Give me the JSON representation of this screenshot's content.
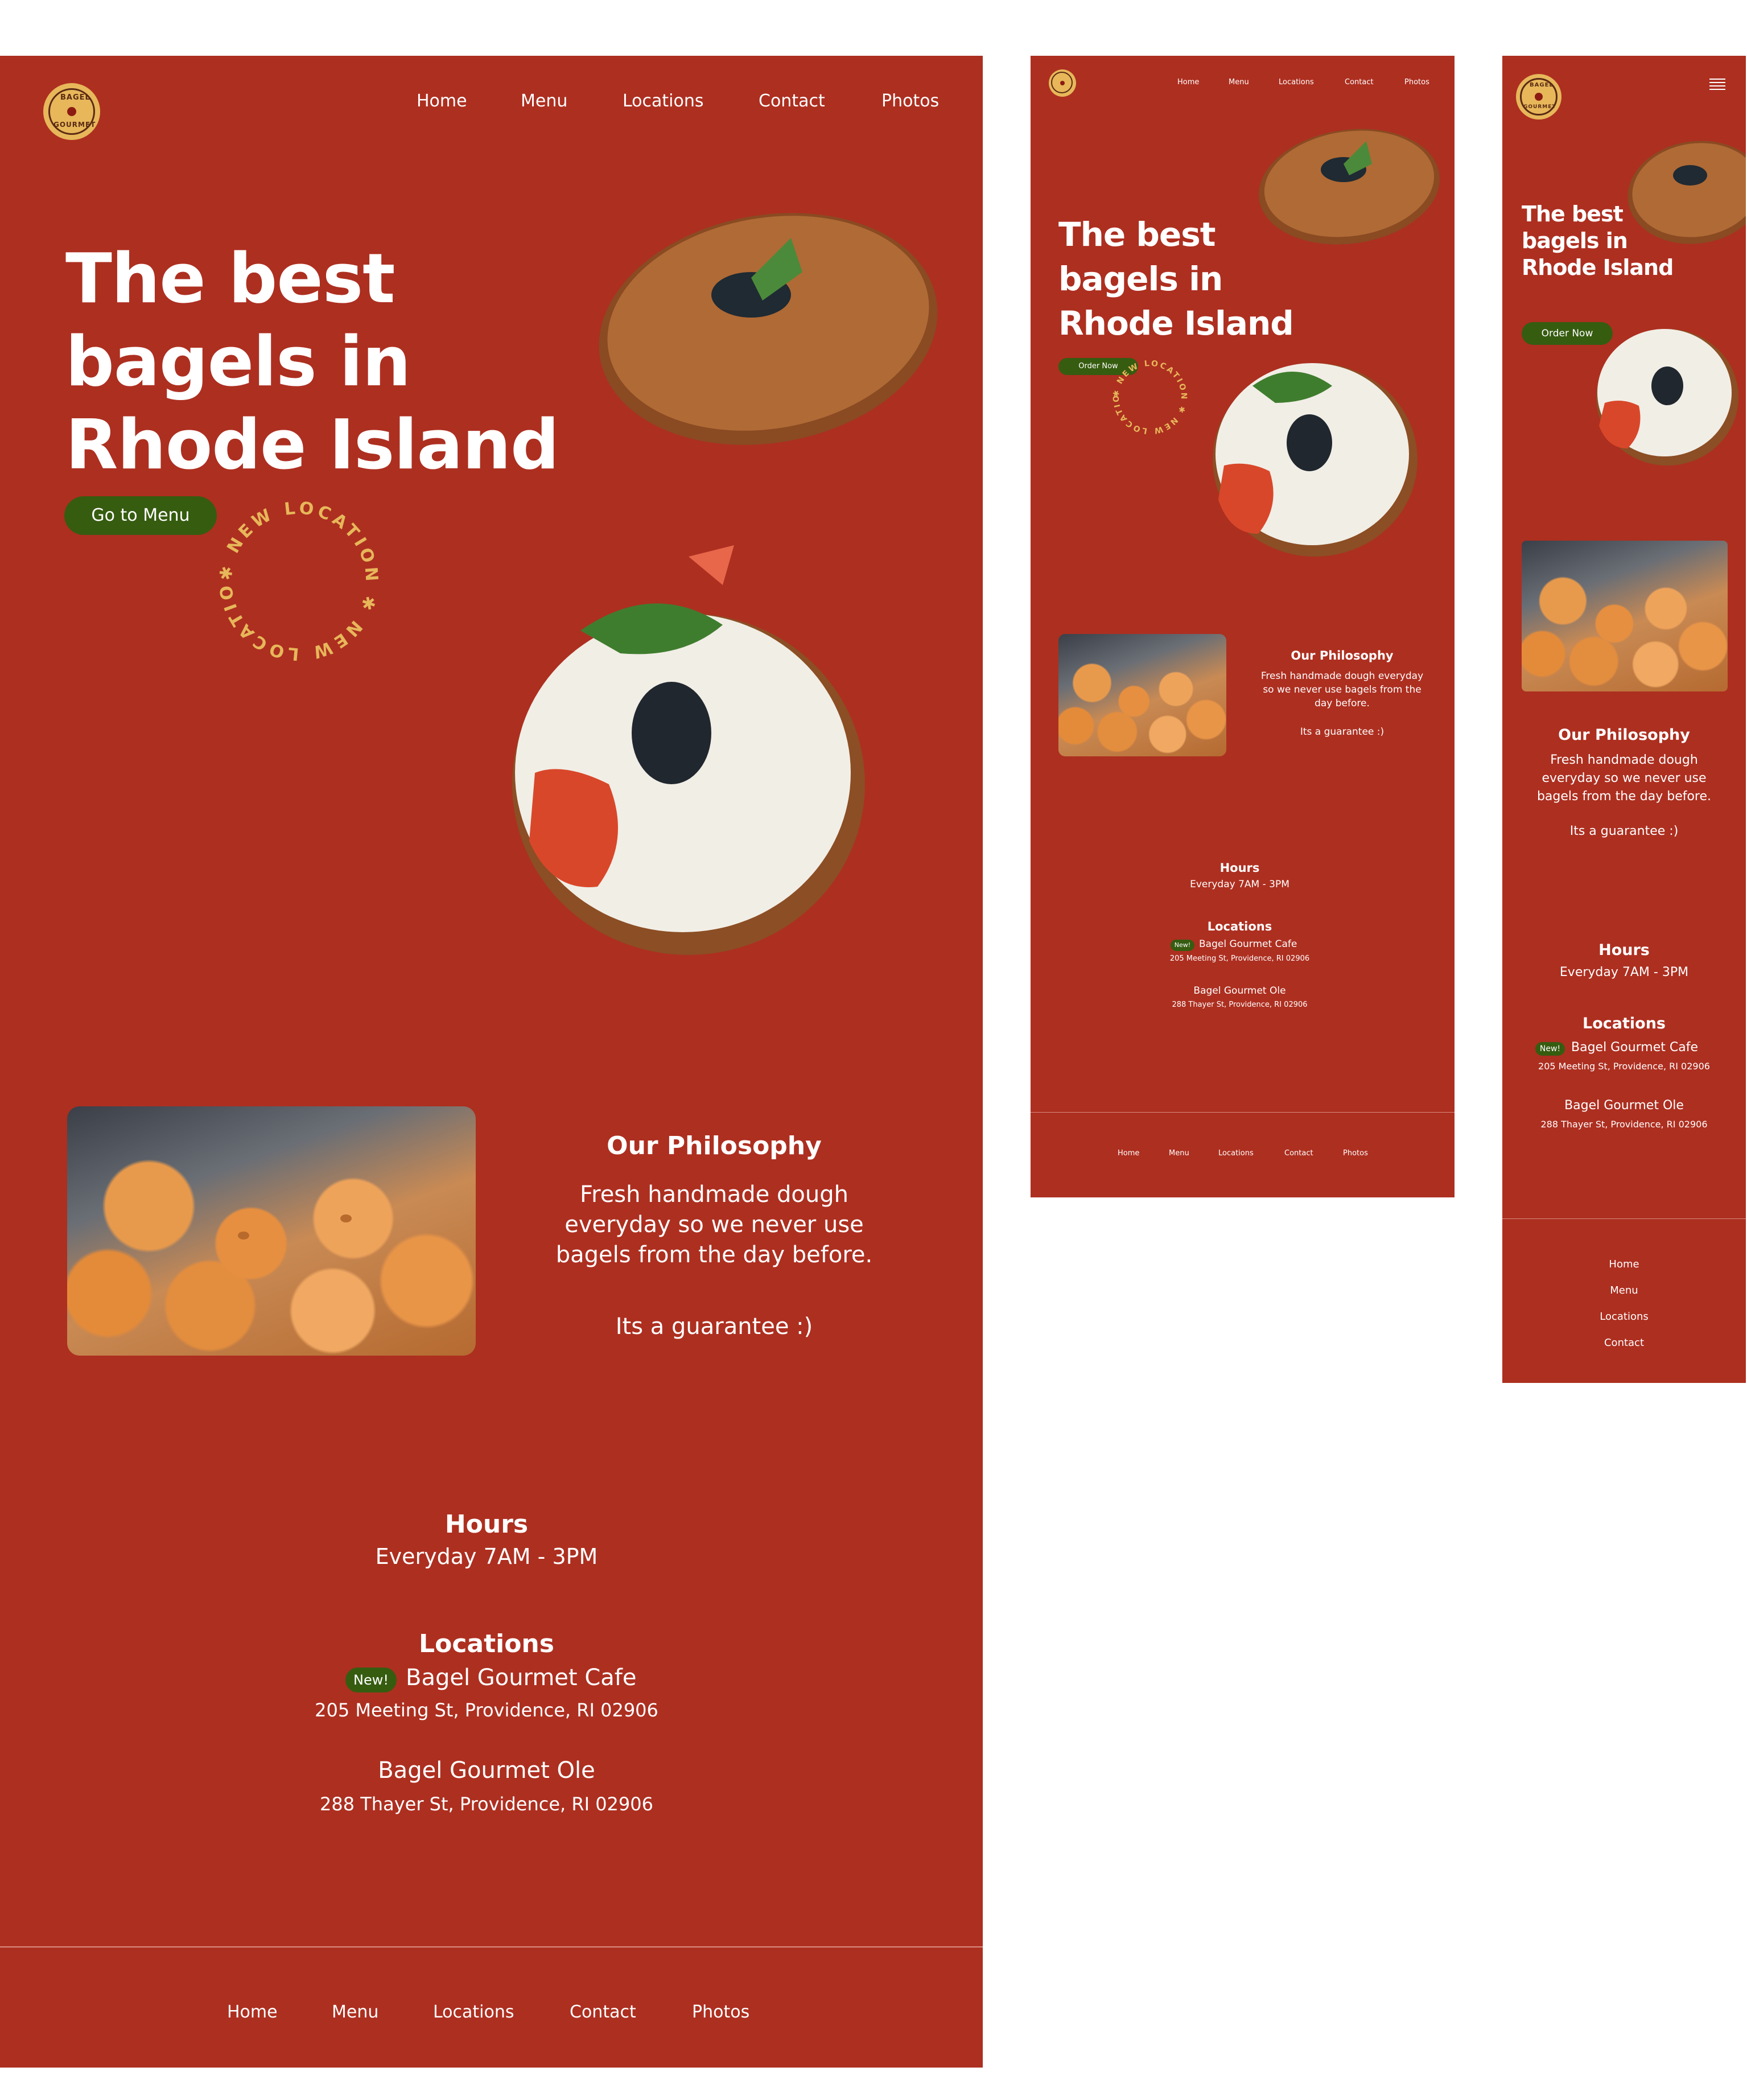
{
  "brand": {
    "logo_line1": "BAGEL",
    "logo_line2": "GOURMET"
  },
  "nav": [
    "Home",
    "Menu",
    "Locations",
    "Contact",
    "Photos"
  ],
  "hero": {
    "line1": "The best",
    "line2": "bagels in",
    "line3": "Rhode Island",
    "desktop_button": "Go to Menu",
    "mobile_button": "Order Now",
    "stamp_text": "✱ NEW LOCATION ✱ NEW LOCATION"
  },
  "philosophy": {
    "title": "Our Philosophy",
    "text_l1": "Fresh handmade dough",
    "text_l2": "everyday so we never use",
    "text_l3": "bagels from the day before.",
    "tab_l1": "Fresh handmade dough everyday",
    "tab_l2": "so we never use bagels from the",
    "tab_l3": "day before.",
    "guarantee": "Its a guarantee :)"
  },
  "hours": {
    "title": "Hours",
    "value": "Everyday 7AM - 3PM"
  },
  "locations": {
    "title": "Locations",
    "badge": "New!",
    "items": [
      {
        "name": "Bagel Gourmet Cafe",
        "address": "205 Meeting St, Providence, RI 02906"
      },
      {
        "name": "Bagel Gourmet Ole",
        "address": "288 Thayer St, Providence, RI 02906"
      }
    ]
  },
  "mobile_footer": [
    "Home",
    "Menu",
    "Locations",
    "Contact"
  ],
  "colors": {
    "background": "#ad2f20",
    "button": "#365c10",
    "accent": "#e7b75a"
  }
}
